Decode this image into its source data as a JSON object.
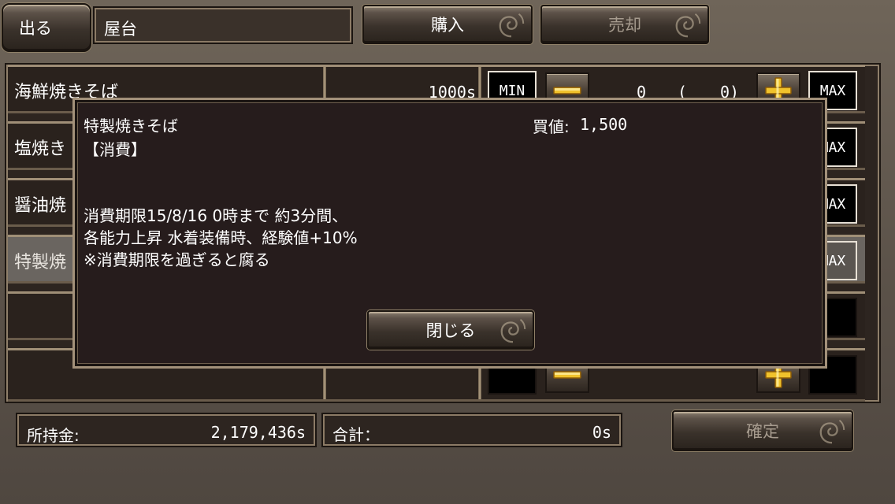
{
  "header": {
    "exit_label": "出る",
    "shop_name": "屋台",
    "buy_label": "購入",
    "sell_label": "売却"
  },
  "table": {
    "rows": [
      {
        "name": "海鮮焼きそば",
        "price": "1000s",
        "min_label": "MIN",
        "max_label": "MAX",
        "quantity": "0",
        "paren_open": "(",
        "paren_value": "0)"
      },
      {
        "name": "塩焼き",
        "max_label": "MAX"
      },
      {
        "name": "醤油焼",
        "max_label": "MAX"
      },
      {
        "name": "特製焼",
        "max_label": "MAX"
      }
    ]
  },
  "footer": {
    "money_label": "所持金:",
    "money_value": "2,179,436s",
    "total_label": "合計：",
    "total_value": "0s",
    "confirm_label": "確定"
  },
  "modal": {
    "item_name": "特製焼きそば",
    "buy_price_label": "買値:",
    "buy_price_value": "1,500",
    "category": "【消費】",
    "desc_line1": "消費期限15/8/16 0時まで 約3分間、",
    "desc_line2": "各能力上昇 水着装備時、経験値+10%",
    "desc_line3": "※消費期限を過ぎると腐る",
    "close_label": "閉じる"
  },
  "icons": [
    "swirl-ornament-icon",
    "minus-icon",
    "plus-icon"
  ],
  "colors": {
    "plus_gold": "#f2c430",
    "bronze_border": "#a3917a",
    "panel_bg": "#261c1c"
  }
}
